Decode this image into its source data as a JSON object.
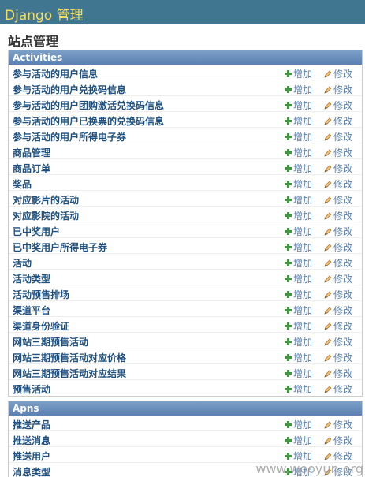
{
  "header": {
    "brand": "Django 管理"
  },
  "page": {
    "title": "站点管理"
  },
  "modules": {
    "activities": {
      "caption": "Activities",
      "rows": [
        {
          "label": "参与活动的用户信息",
          "add": "增加",
          "change": "修改"
        },
        {
          "label": "参与活动的用户兑换码信息",
          "add": "增加",
          "change": "修改"
        },
        {
          "label": "参与活动的用户团购激活兑换码信息",
          "add": "增加",
          "change": "修改"
        },
        {
          "label": "参与活动的用户已换票的兑换码信息",
          "add": "增加",
          "change": "修改"
        },
        {
          "label": "参与活动的用户所得电子券",
          "add": "增加",
          "change": "修改"
        },
        {
          "label": "商品管理",
          "add": "增加",
          "change": "修改"
        },
        {
          "label": "商品订单",
          "add": "增加",
          "change": "修改"
        },
        {
          "label": "奖品",
          "add": "增加",
          "change": "修改"
        },
        {
          "label": "对应影片的活动",
          "add": "增加",
          "change": "修改"
        },
        {
          "label": "对应影院的活动",
          "add": "增加",
          "change": "修改"
        },
        {
          "label": "已中奖用户",
          "add": "增加",
          "change": "修改"
        },
        {
          "label": "已中奖用户所得电子券",
          "add": "增加",
          "change": "修改"
        },
        {
          "label": "活动",
          "add": "增加",
          "change": "修改"
        },
        {
          "label": "活动类型",
          "add": "增加",
          "change": "修改"
        },
        {
          "label": "活动预售排场",
          "add": "增加",
          "change": "修改"
        },
        {
          "label": "渠道平台",
          "add": "增加",
          "change": "修改"
        },
        {
          "label": "渠道身份验证",
          "add": "增加",
          "change": "修改"
        },
        {
          "label": "网站三期预售活动",
          "add": "增加",
          "change": "修改"
        },
        {
          "label": "网站三期预售活动对应价格",
          "add": "增加",
          "change": "修改"
        },
        {
          "label": "网站三期预售活动对应结果",
          "add": "增加",
          "change": "修改"
        },
        {
          "label": "预售活动",
          "add": "增加",
          "change": "修改"
        }
      ]
    },
    "apns": {
      "caption": "Apns",
      "rows": [
        {
          "label": "推送产品",
          "add": "增加",
          "change": "修改"
        },
        {
          "label": "推送消息",
          "add": "增加",
          "change": "修改"
        },
        {
          "label": "推送用户",
          "add": "增加",
          "change": "修改"
        },
        {
          "label": "消息类型",
          "add": "增加",
          "change": "修改"
        }
      ]
    }
  },
  "watermark": "www.wooyun.org",
  "colors": {
    "header_bg": "#417690",
    "brand_text": "#f5dd5d",
    "caption_bg": "#5b80b2",
    "link": "#5b80b2",
    "add_icon": "#3c9a3c"
  },
  "icons": {
    "add": "plus-icon",
    "change": "pencil-icon"
  }
}
